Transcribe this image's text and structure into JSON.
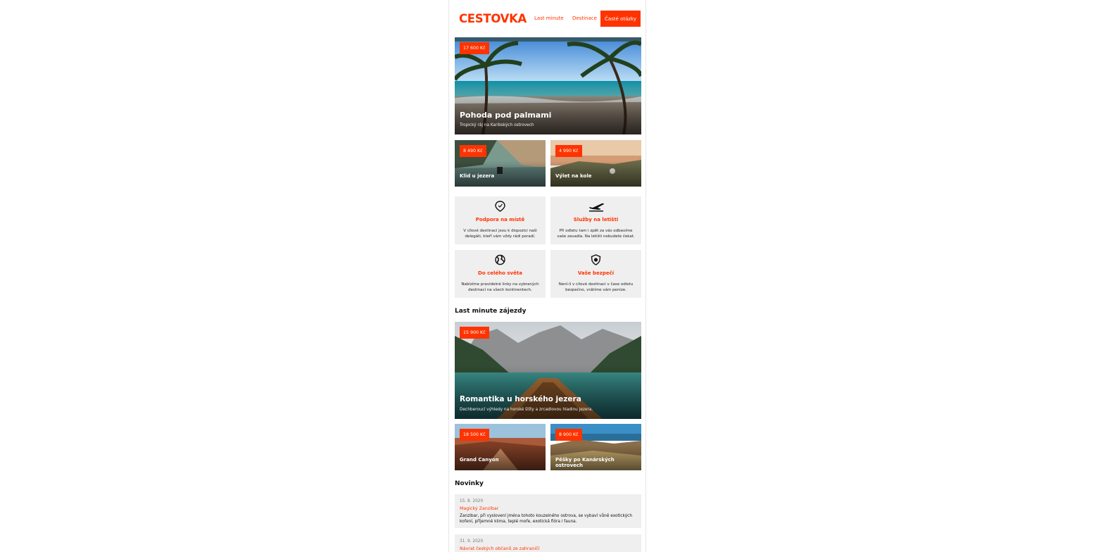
{
  "header": {
    "logo": "CESTOVKA",
    "nav": [
      "Last minute",
      "Destinace",
      "Časté otázky"
    ]
  },
  "hero": {
    "price": "17 600 Kč",
    "title": "Pohoda pod palmami",
    "subtitle": "Tropický ráj na Karibských ostrovech"
  },
  "small_cards": [
    {
      "price": "8 490 Kč",
      "title": "Klid u jezera"
    },
    {
      "price": "4 990 Kč",
      "title": "Výlet na kole"
    }
  ],
  "features": [
    {
      "icon": "location-pin-icon",
      "title": "Podpora na místě",
      "text": "V cílové destinaci jsou k dispozici naši delegáti, kteří vám vždy rádi poradí."
    },
    {
      "icon": "airplane-icon",
      "title": "Služby na letišti",
      "text": "Při odletu tam i zpět za vás odbavíme vaše zavadla. Na letišti nebudete čekat."
    },
    {
      "icon": "globe-icon",
      "title": "Do celého světa",
      "text": "Nabízíme pravidelné linky na vybraných destinací na všech kontinentech."
    },
    {
      "icon": "shield-icon",
      "title": "Vaše bezpečí",
      "text": "Není-li v cílové destinaci v čase odletu bezpečno, vrátíme vám peníze."
    }
  ],
  "last_minute": {
    "heading": "Last minute zájezdy",
    "hero": {
      "price": "15 900 Kč",
      "title": "Romantika u horského jezera",
      "subtitle": "Dechberoucí výhledy na horské štíty a zrcadlovou hladinu jezera."
    },
    "small_cards": [
      {
        "price": "18 500 Kč",
        "title": "Grand Canyon"
      },
      {
        "price": "8 900 Kč",
        "title": "Pěšky po Kanárských ostrovech"
      }
    ]
  },
  "news": {
    "heading": "Novinky",
    "items": [
      {
        "date": "15. 8. 2020",
        "title": "Magický Zanzibar",
        "text": "Zanzibar, při vyslovení jména tohoto kouzelného ostrova, se vybaví vůně exotických koření, příjemné klima, teplé moře, exotická flóra i fauna."
      },
      {
        "date": "31. 9. 2020",
        "title": "Návrat českých občanů ze zahraničí",
        "text": ""
      }
    ]
  },
  "colors": {
    "accent": "#ff3300",
    "panel": "#efefef"
  }
}
